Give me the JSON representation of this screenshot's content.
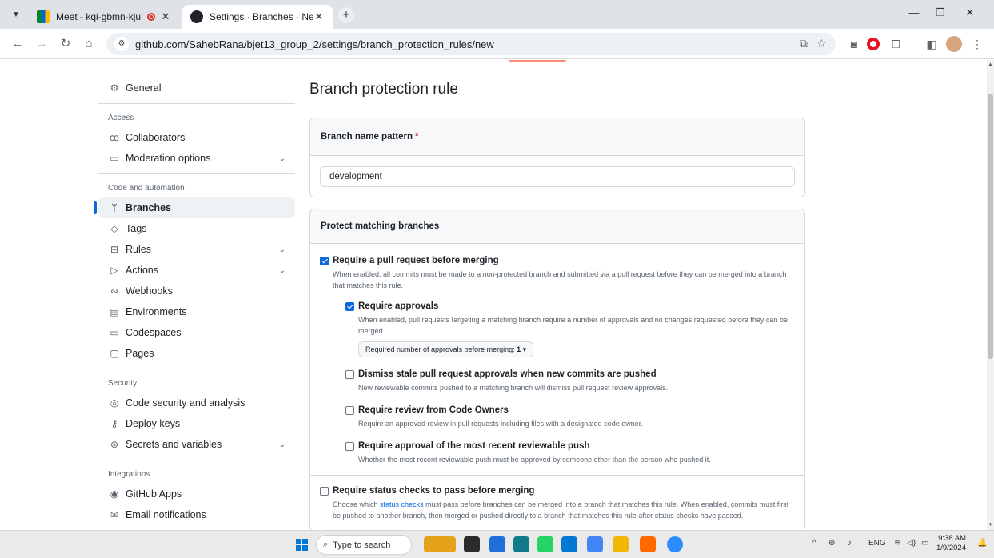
{
  "browser": {
    "tabs": [
      {
        "title": "Meet - kqi-gbmn-kju",
        "active": false
      },
      {
        "title": "Settings · Branches · New branch",
        "active": true
      }
    ],
    "url": "github.com/SahebRana/bjet13_group_2/settings/branch_protection_rules/new",
    "icons": [
      "back-icon",
      "forward-icon",
      "reload-icon",
      "home-icon",
      "site-info-icon",
      "install-app-icon",
      "bookmark-star-icon",
      "camera-icon",
      "opera-icon",
      "extensions-icon",
      "side-panel-icon",
      "profile-avatar-icon",
      "menu-icon"
    ]
  },
  "sidebar": {
    "top": [
      {
        "label": "General",
        "icon": "gear-icon"
      }
    ],
    "sections": [
      {
        "heading": "Access",
        "items": [
          {
            "label": "Collaborators",
            "icon": "people-icon",
            "chevron": false,
            "active": false
          },
          {
            "label": "Moderation options",
            "icon": "comment-discussion-icon",
            "chevron": true,
            "active": false
          }
        ]
      },
      {
        "heading": "Code and automation",
        "items": [
          {
            "label": "Branches",
            "icon": "git-branch-icon",
            "chevron": false,
            "active": true
          },
          {
            "label": "Tags",
            "icon": "tag-icon",
            "chevron": false,
            "active": false
          },
          {
            "label": "Rules",
            "icon": "repo-push-icon",
            "chevron": true,
            "active": false
          },
          {
            "label": "Actions",
            "icon": "play-icon",
            "chevron": true,
            "active": false
          },
          {
            "label": "Webhooks",
            "icon": "webhook-icon",
            "chevron": false,
            "active": false
          },
          {
            "label": "Environments",
            "icon": "server-icon",
            "chevron": false,
            "active": false
          },
          {
            "label": "Codespaces",
            "icon": "codespaces-icon",
            "chevron": false,
            "active": false
          },
          {
            "label": "Pages",
            "icon": "browser-icon",
            "chevron": false,
            "active": false
          }
        ]
      },
      {
        "heading": "Security",
        "items": [
          {
            "label": "Code security and analysis",
            "icon": "codescan-icon",
            "chevron": false,
            "active": false
          },
          {
            "label": "Deploy keys",
            "icon": "key-icon",
            "chevron": false,
            "active": false
          },
          {
            "label": "Secrets and variables",
            "icon": "asterisk-icon",
            "chevron": true,
            "active": false
          }
        ]
      },
      {
        "heading": "Integrations",
        "items": [
          {
            "label": "GitHub Apps",
            "icon": "apps-icon",
            "chevron": false,
            "active": false
          },
          {
            "label": "Email notifications",
            "icon": "mail-icon",
            "chevron": false,
            "active": false
          }
        ]
      }
    ]
  },
  "main": {
    "title": "Branch protection rule",
    "pattern": {
      "label": "Branch name pattern",
      "required_mark": "*",
      "value": "development"
    },
    "protect": {
      "header": "Protect matching branches",
      "require_pr": {
        "label": "Require a pull request before merging",
        "checked": true,
        "desc": "When enabled, all commits must be made to a non-protected branch and submitted via a pull request before they can be merged into a branch that matches this rule.",
        "approvals": {
          "label": "Require approvals",
          "checked": true,
          "desc": "When enabled, pull requests targeting a matching branch require a number of approvals and no changes requested before they can be merged.",
          "dropdown_prefix": "Required number of approvals before merging: ",
          "dropdown_value": "1"
        },
        "dismiss": {
          "label": "Dismiss stale pull request approvals when new commits are pushed",
          "checked": false,
          "desc": "New reviewable commits pushed to a matching branch will dismiss pull request review approvals."
        },
        "codeowners": {
          "label": "Require review from Code Owners",
          "checked": false,
          "desc": "Require an approved review in pull requests including files with a designated code owner."
        },
        "recent_push": {
          "label": "Require approval of the most recent reviewable push",
          "checked": false,
          "desc": "Whether the most recent reviewable push must be approved by someone other than the person who pushed it."
        }
      },
      "status_checks": {
        "label": "Require status checks to pass before merging",
        "checked": false,
        "desc_pre": "Choose which ",
        "desc_link": "status checks",
        "desc_post": " must pass before branches can be merged into a branch that matches this rule. When enabled, commits must first be pushed to another branch, then merged or pushed directly to a branch that matches this rule after status checks have passed."
      }
    }
  },
  "taskbar": {
    "search_placeholder": "Type to search",
    "lang": "ENG",
    "time": "9:38 AM",
    "date": "1/9/2024",
    "app_colors": [
      "#e3a21a",
      "#2b2b2b",
      "#1e6fd9",
      "#0f7b8a",
      "#25d366",
      "#0078d4",
      "#4285f4",
      "#f2b705",
      "#ff6a00",
      "#2d8cff"
    ]
  }
}
